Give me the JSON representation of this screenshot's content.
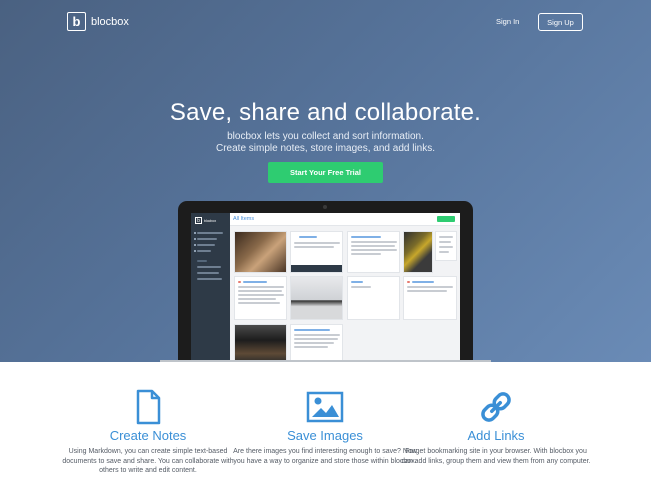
{
  "header": {
    "logo_letter": "b",
    "logo_text": "blocbox",
    "signin_label": "Sign In",
    "signup_label": "Sign Up"
  },
  "hero": {
    "headline": "Save, share and collaborate.",
    "sub_line1": "blocbox lets you collect and sort information.",
    "sub_line2": "Create simple notes, store images, and add links.",
    "cta_label": "Start Your Free Trial"
  },
  "mockup": {
    "logo_letter": "b",
    "logo_text": "blocbox",
    "title": "All Items"
  },
  "features": [
    {
      "icon": "document-icon",
      "title": "Create Notes",
      "desc": "Using Markdown, you can create simple text-based documents to save and share. You can collaborate with others to write and edit content."
    },
    {
      "icon": "image-icon",
      "title": "Save Images",
      "desc": "Are there images you find interesting enough to save? Now you have a way to organize and store those within blocbox."
    },
    {
      "icon": "link-icon",
      "title": "Add Links",
      "desc": "Forget bookmarking site in your browser. With blocbox you can add links, group them and view them from any computer."
    }
  ],
  "colors": {
    "accent_blue": "#3a8fd6",
    "cta_green": "#2ecc71",
    "hero_bg": "#56739a"
  }
}
